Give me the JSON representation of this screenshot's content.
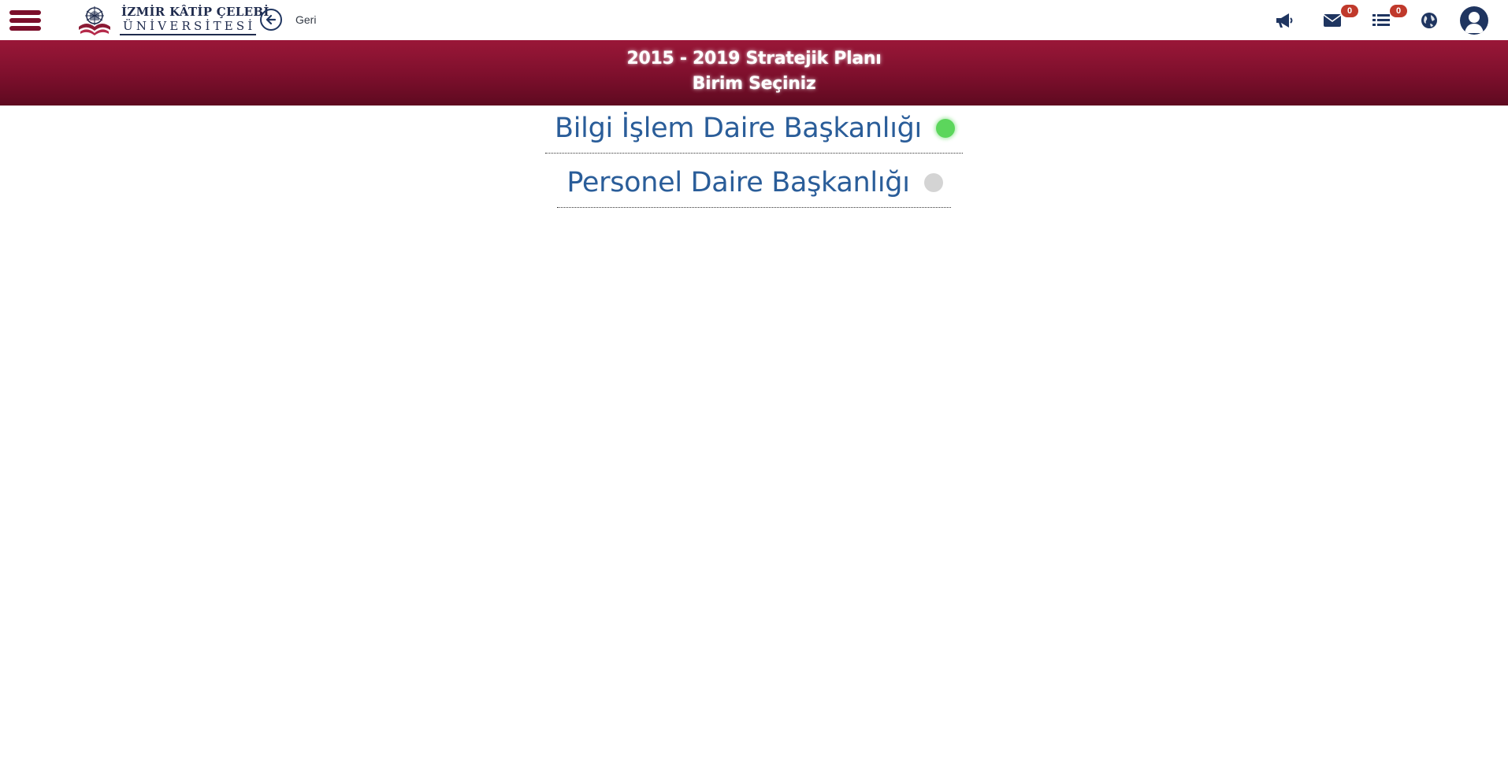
{
  "header": {
    "logo": {
      "line1": "İZMİR KÂTİP ÇELEBİ",
      "line2": "ÜNİVERSİTESİ"
    },
    "back_label": "Geri",
    "icons": {
      "menu": "hamburger-menu-icon",
      "back": "arrow-left-circle-icon",
      "announcements": "megaphone-icon",
      "messages": "envelope-icon",
      "tasks": "list-icon",
      "language": "globe-icon",
      "profile": "user-avatar-icon"
    },
    "messages_count": "0",
    "tasks_count": "0"
  },
  "banner": {
    "title": "2015 - 2019 Stratejik Planı",
    "subtitle": "Birim Seçiniz"
  },
  "units": [
    {
      "label": "Bilgi İşlem Daire Başkanlığı",
      "status": "active",
      "status_color": "#5cd65c"
    },
    {
      "label": "Personel Daire Başkanlığı",
      "status": "inactive",
      "status_color": "#d4d4d4"
    }
  ],
  "colors": {
    "brand": "#7d0f2c",
    "link_text": "#2a5d99",
    "icon": "#1f3560",
    "badge": "#c0392b"
  }
}
